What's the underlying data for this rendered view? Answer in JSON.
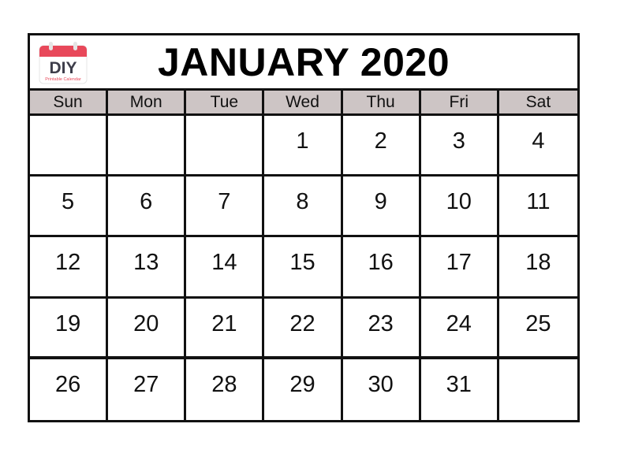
{
  "calendar": {
    "title": "JANUARY 2020",
    "logo": {
      "text": "DIY",
      "subtitle": "Printable Calendar",
      "icon": "calendar-icon",
      "accent_color": "#e8485a"
    },
    "header_bg_color": "#cdc5c5",
    "weekdays": [
      "Sun",
      "Mon",
      "Tue",
      "Wed",
      "Thu",
      "Fri",
      "Sat"
    ],
    "weeks": [
      [
        "",
        "",
        "",
        "1",
        "2",
        "3",
        "4"
      ],
      [
        "5",
        "6",
        "7",
        "8",
        "9",
        "10",
        "11"
      ],
      [
        "12",
        "13",
        "14",
        "15",
        "16",
        "17",
        "18"
      ],
      [
        "19",
        "20",
        "21",
        "22",
        "23",
        "24",
        "25"
      ],
      [
        "26",
        "27",
        "28",
        "29",
        "30",
        "31",
        ""
      ]
    ]
  }
}
